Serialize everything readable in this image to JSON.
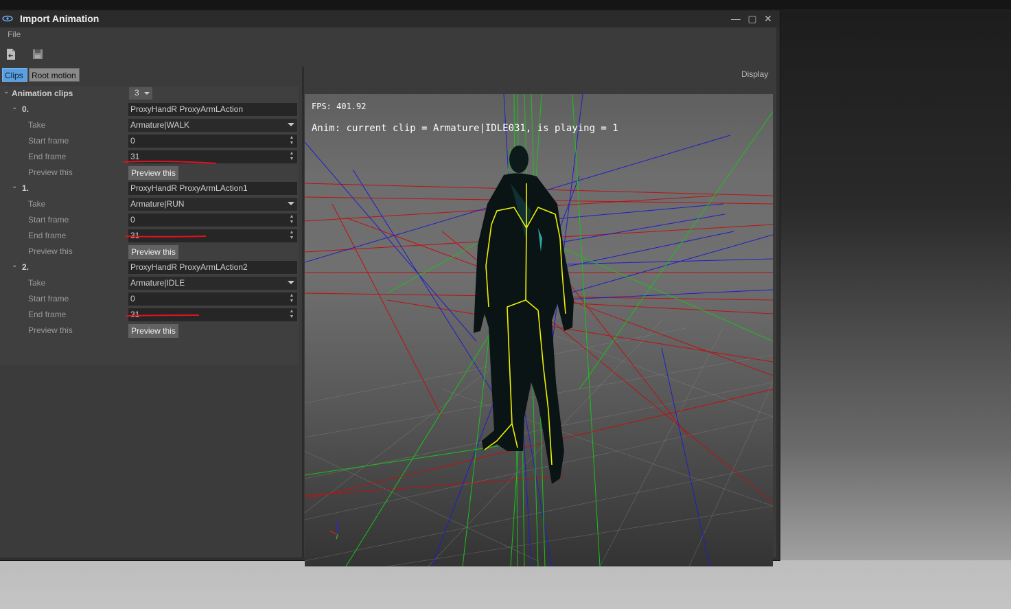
{
  "window": {
    "title": "Import Animation"
  },
  "menu": {
    "file": "File"
  },
  "tabs": {
    "clips": "Clips",
    "root_motion": "Root motion"
  },
  "display_label": "Display",
  "animation_clips": {
    "label": "Animation clips",
    "count": "3",
    "labels": {
      "take": "Take",
      "start": "Start frame",
      "end": "End frame",
      "preview": "Preview this"
    },
    "clips": [
      {
        "index": "0.",
        "name": "ProxyHandR ProxyArmLAction",
        "take": "Armature|WALK",
        "start_frame": "0",
        "end_frame": "31",
        "preview_button": "Preview this"
      },
      {
        "index": "1.",
        "name": "ProxyHandR ProxyArmLAction1",
        "take": "Armature|RUN",
        "start_frame": "0",
        "end_frame": "31",
        "preview_button": "Preview this"
      },
      {
        "index": "2.",
        "name": "ProxyHandR ProxyArmLAction2",
        "take": "Armature|IDLE",
        "start_frame": "0",
        "end_frame": "31",
        "preview_button": "Preview this"
      }
    ]
  },
  "viewport": {
    "fps": "FPS: 401.92",
    "anim_status": "Anim: current clip = Armature|IDLE031, is playing = 1"
  },
  "colors": {
    "accent_tab": "#5aa0e0",
    "annotation": "#e0121e",
    "bone": "#f0f000"
  }
}
